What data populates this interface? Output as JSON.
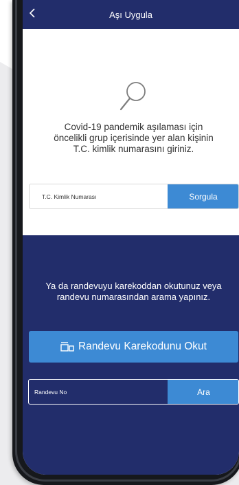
{
  "header": {
    "title": "Aşı Uygula",
    "back_icon": "chevron-left-icon"
  },
  "query": {
    "icon": "search-icon",
    "description_line1": "Covid-19 pandemik aşılaması için",
    "description_line2": "öncelikli grup içerisinde yer alan kişinin",
    "description_line3": "T.C. kimlik numarasını giriniz.",
    "tc_placeholder": "T.C. Kimlik Numarası",
    "tc_value": "",
    "query_button": "Sorgula"
  },
  "appointment": {
    "text_line1": "Ya da randevuyu karekoddan okutunuz veya",
    "text_line2": "randevu numarasından arama yapınız.",
    "qr_icon": "qr-scan-icon",
    "qr_button": "Randevu Karekodunu Okut",
    "appointment_placeholder": "Randevu No",
    "appointment_value": "",
    "search_button": "Ara"
  },
  "colors": {
    "navy": "#222d6b",
    "accent_blue": "#3d8ad4",
    "background_gray": "#ececee"
  }
}
